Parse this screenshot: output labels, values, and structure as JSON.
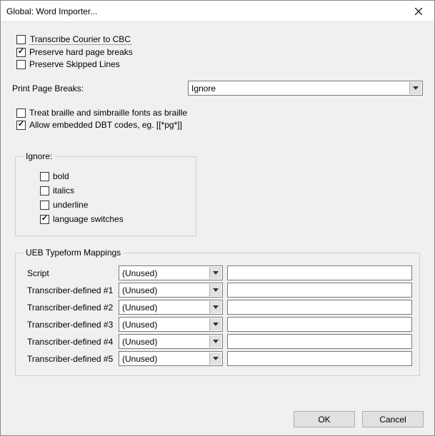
{
  "window": {
    "title": "Global: Word Importer..."
  },
  "checks": {
    "transcribe": {
      "label": "Transcribe Courier to CBC",
      "checked": false,
      "highlighted": true
    },
    "preserveHard": {
      "label": "Preserve hard page breaks",
      "checked": true
    },
    "preserveSkipped": {
      "label": "Preserve Skipped Lines",
      "checked": false
    },
    "treatBraille": {
      "label": "Treat braille and simbraille fonts as braille",
      "checked": false
    },
    "allowEmbedded": {
      "label": "Allow embedded DBT codes, eg. [[*pg*]]",
      "checked": true
    }
  },
  "printPageBreaks": {
    "label": "Print Page Breaks:",
    "value": "Ignore"
  },
  "ignore": {
    "legend": "Ignore:",
    "bold": {
      "label": "bold",
      "checked": false
    },
    "italics": {
      "label": "italics",
      "checked": false
    },
    "underline": {
      "label": "underline",
      "checked": false
    },
    "langsw": {
      "label": "language switches",
      "checked": true
    }
  },
  "ueb": {
    "legend": "UEB Typeform Mappings",
    "rows": [
      {
        "label": "Script",
        "value": "(Unused)",
        "text": ""
      },
      {
        "label": "Transcriber-defined #1",
        "value": "(Unused)",
        "text": ""
      },
      {
        "label": "Transcriber-defined #2",
        "value": "(Unused)",
        "text": ""
      },
      {
        "label": "Transcriber-defined #3",
        "value": "(Unused)",
        "text": ""
      },
      {
        "label": "Transcriber-defined #4",
        "value": "(Unused)",
        "text": ""
      },
      {
        "label": "Transcriber-defined #5",
        "value": "(Unused)",
        "text": ""
      }
    ]
  },
  "buttons": {
    "ok": "OK",
    "cancel": "Cancel"
  }
}
